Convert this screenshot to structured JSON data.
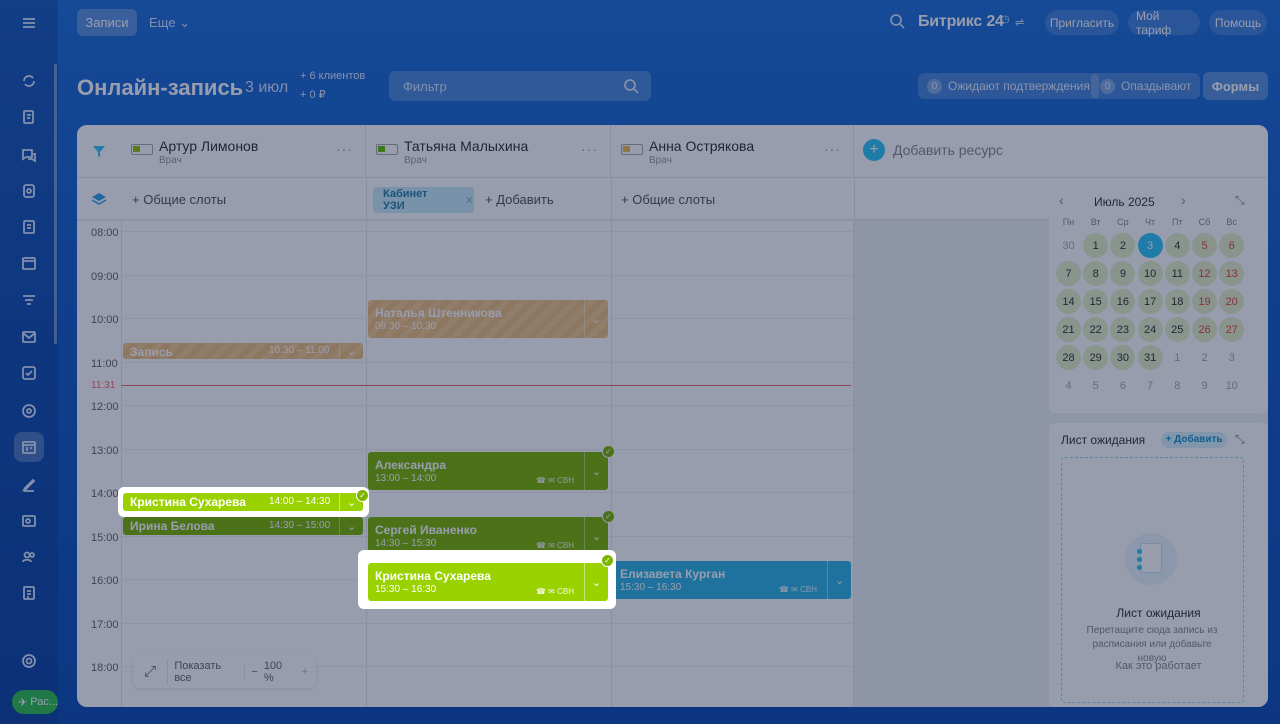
{
  "topbar": {
    "tab_active": "Записи",
    "tab_more": "Еще",
    "brand": "Битрикс 24",
    "buttons": [
      "Пригласить",
      "Мой тариф",
      "Помощь"
    ]
  },
  "page": {
    "title": "Онлайн-запись",
    "date": "3 июл",
    "clients_stat": "+ 6 клиентов",
    "money_stat": "+ 0 ₽",
    "filter_placeholder": "Фильтр",
    "awaiting_count": "0",
    "awaiting_label": "Ожидают подтверждения",
    "late_count": "0",
    "late_label": "Опаздывают",
    "forms_label": "Формы"
  },
  "resources": [
    {
      "name": "Артур Лимонов",
      "role": "Врач"
    },
    {
      "name": "Татьяна Малыхина",
      "role": "Врач"
    },
    {
      "name": "Анна Острякова",
      "role": "Врач"
    }
  ],
  "add_resource": "Добавить ресурс",
  "slots": {
    "common": "+ Общие слоты",
    "room": "Кабинет УЗИ",
    "add": "+ Добавить"
  },
  "times": [
    "08:00",
    "09:00",
    "10:00",
    "11:00",
    "12:00",
    "13:00",
    "14:00",
    "15:00",
    "16:00",
    "17:00",
    "18:00"
  ],
  "now": "11:31",
  "events": [
    {
      "title": "Запись",
      "time": "10:30 – 11:00"
    },
    {
      "title": "Наталья Штенникова",
      "time": "09:30 – 10:30"
    },
    {
      "title": "Александра",
      "time": "13:00 – 14:00"
    },
    {
      "title": "Кристина Сухарева",
      "time": "14:00 – 14:30"
    },
    {
      "title": "Ирина Белова",
      "time": "14:30 – 15:00"
    },
    {
      "title": "Сергей Иваненко",
      "time": "14:30 – 15:30"
    },
    {
      "title": "Кристина Сухарева",
      "time": "15:30 – 16:30"
    },
    {
      "title": "Елизавета Курган",
      "time": "15:30 – 16:30"
    }
  ],
  "zoom": {
    "show_all": "Показать все",
    "level": "100 %"
  },
  "calendar": {
    "month": "Июль 2025",
    "weekdays": [
      "Пн",
      "Вт",
      "Ср",
      "Чт",
      "Пт",
      "Сб",
      "Вс"
    ],
    "days": [
      "30",
      "1",
      "2",
      "3",
      "4",
      "5",
      "6",
      "7",
      "8",
      "9",
      "10",
      "11",
      "12",
      "13",
      "14",
      "15",
      "16",
      "17",
      "18",
      "19",
      "20",
      "21",
      "22",
      "23",
      "24",
      "25",
      "26",
      "27",
      "28",
      "29",
      "30",
      "31",
      "1",
      "2",
      "3",
      "4",
      "5",
      "6",
      "7",
      "8",
      "9",
      "10"
    ],
    "today": "3"
  },
  "waitlist": {
    "title": "Лист ожидания",
    "add": "+ Добавить",
    "empty_title": "Лист ожидания",
    "empty_text": "Перетащите сюда запись из расписания или добавьте новую",
    "how": "Как это работает"
  },
  "sidebar_bottom": "Рас..."
}
